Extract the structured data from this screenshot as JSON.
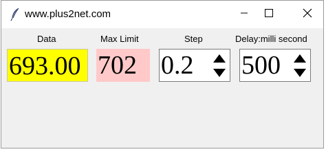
{
  "window": {
    "title": "www.plus2net.com",
    "icons": {
      "app": "feather-icon",
      "minimize": "minimize-icon",
      "maximize": "maximize-icon",
      "close": "close-icon"
    }
  },
  "labels": {
    "data": "Data",
    "max_limit": "Max Limit",
    "step": "Step",
    "delay": "Delay:milli second"
  },
  "fields": {
    "data_value": "693.00",
    "max_limit_value": "702",
    "step_value": "0.2",
    "delay_value": "500"
  },
  "colors": {
    "data_bg": "#ffff00",
    "max_limit_bg": "#ffc9c9"
  }
}
